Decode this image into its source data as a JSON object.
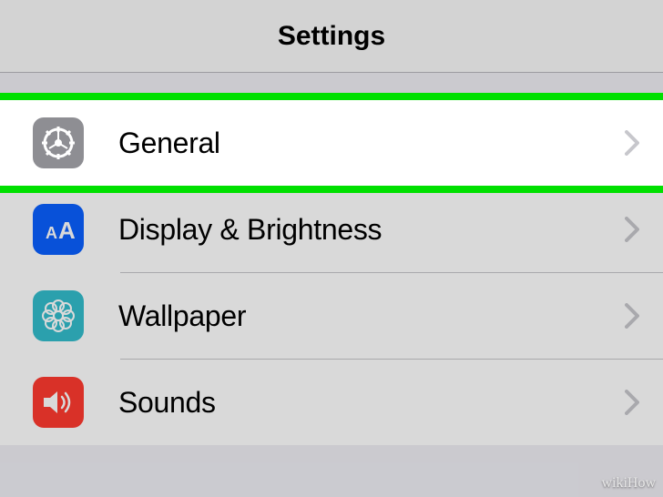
{
  "header": {
    "title": "Settings"
  },
  "rows": {
    "general": {
      "label": "General"
    },
    "display": {
      "label": "Display & Brightness"
    },
    "wallpaper": {
      "label": "Wallpaper"
    },
    "sounds": {
      "label": "Sounds"
    }
  },
  "watermark": "wikiHow"
}
